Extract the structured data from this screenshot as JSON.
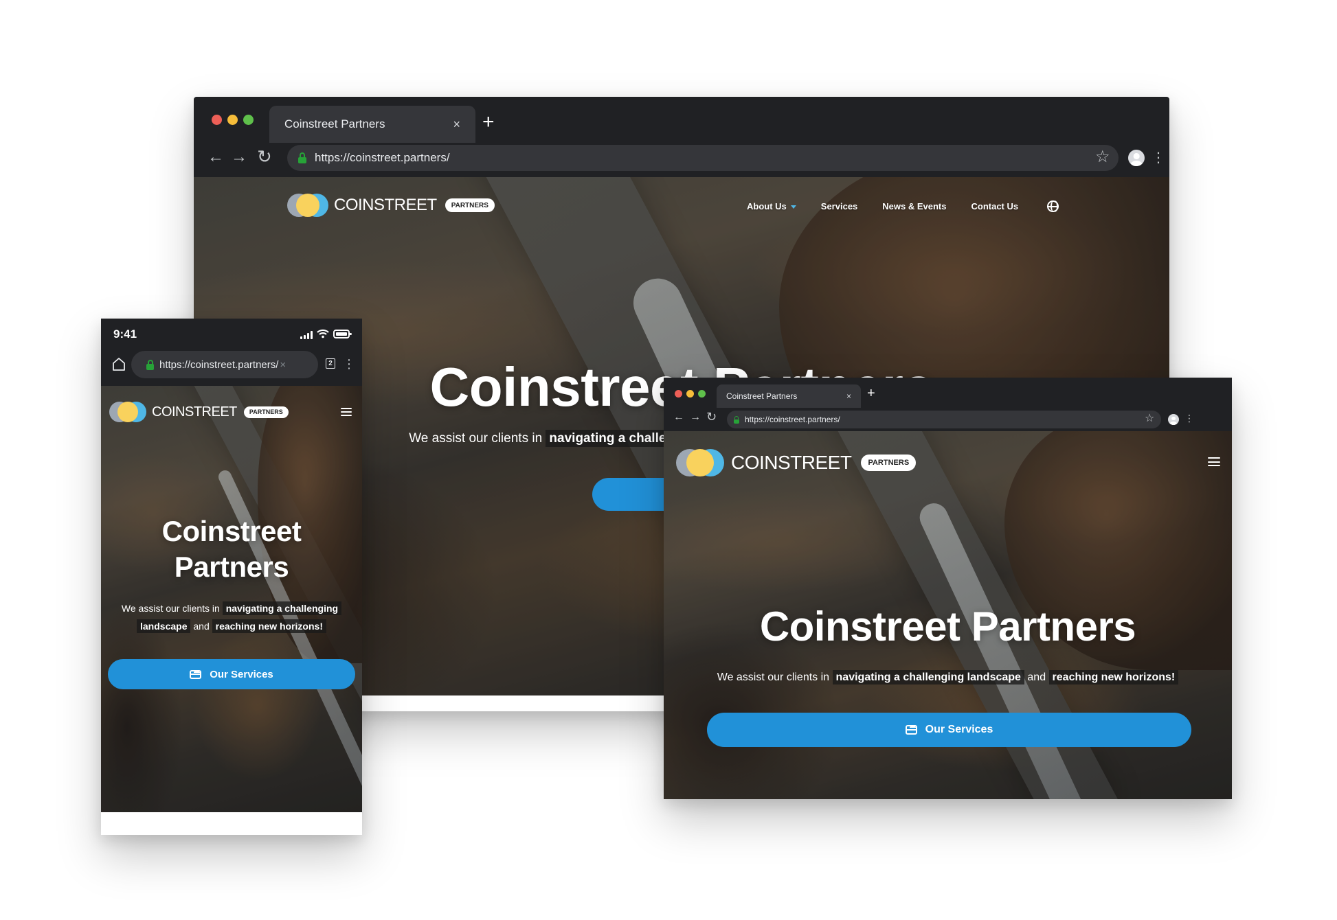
{
  "site": {
    "tab_title": "Coinstreet Partners",
    "url": "https://coinstreet.partners/",
    "logo_word": "COINSTREET",
    "logo_badge": "PARTNERS",
    "hero_title": "Coinstreet Partners",
    "hero_title_line1": "Coinstreet",
    "hero_title_line2": "Partners",
    "hero_sub_pre": "We assist our clients in",
    "hero_sub_hl1": "navigating a challenging landscape",
    "hero_sub_hl1_a": "navigating a challenging",
    "hero_sub_hl1_b": "landscape",
    "hero_sub_mid": "and",
    "hero_sub_hl2": "reaching new horizons!",
    "cta_label": "Our Services",
    "colors": {
      "accent": "#2191d8",
      "chrome_bg": "#202124",
      "tab_bg": "#35363a",
      "lock_green": "#27a338",
      "logo_yellow": "#f9d25d",
      "logo_blue": "#4fb7e6",
      "logo_grey": "#a7b2c1",
      "nav_caret": "#4fb7e6"
    }
  },
  "desktop": {
    "nav": [
      {
        "label": "About Us",
        "has_dropdown": true
      },
      {
        "label": "Services"
      },
      {
        "label": "News & Events"
      },
      {
        "label": "Contact Us"
      }
    ],
    "language_icon": "globe-icon",
    "tab_close": "×",
    "new_tab": "+"
  },
  "tablet": {
    "tab_close": "×",
    "new_tab": "+",
    "menu_icon": "hamburger-icon"
  },
  "phone": {
    "time": "9:41",
    "open_tabs": "2",
    "url_clear": "×",
    "menu_icon": "hamburger-icon"
  },
  "icons": {
    "back": "←",
    "forward": "→",
    "reload": "↻",
    "star": "☆",
    "kebab": "⋮"
  }
}
